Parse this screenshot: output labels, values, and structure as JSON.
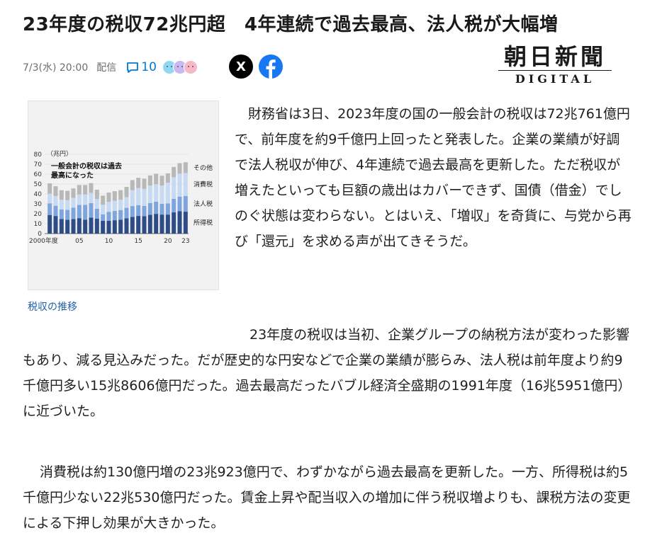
{
  "article": {
    "headline": "23年度の税収72兆円超　4年連続で過去最高、法人税が大幅増",
    "date": "7/3(水) 20:00",
    "delivery_label": "配信",
    "comment_count": "10",
    "share_x_label": "X",
    "publisher_logo_jp": "朝日新聞",
    "publisher_logo_en": "DIGITAL",
    "figure_caption": "税収の推移",
    "paragraphs": [
      "財務省は3日、2023年度の国の一般会計の税収は72兆761億円で、前年度を約9千億円上回ったと発表した。企業の業績が好調で法人税収が伸び、4年連続で過去最高を更新した。ただ税収が増えたといっても巨額の歳出はカバーできず、国債（借金）でしのぐ状態は変わらない。とはいえ、「増収」を奇貨に、与党から再び「還元」を求める声が出てきそうだ。",
      "23年度の税収は当初、企業グループの納税方法が変わった影響もあり、減る見込みだった。だが歴史的な円安などで企業の業績が膨らみ、法人税は前年度より約9千億円多い15兆8606億円だった。過去最高だったバブル経済全盛期の1991年度（16兆5951億円）に近づいた。",
      "消費税は約130億円増の23兆923億円で、わずかながら過去最高を更新した。一方、所得税は約5千億円少ない22兆530億円だった。賃金上昇や配当収入の増加に伴う税収増よりも、課税方法の変更による下押し効果が大きかった。"
    ]
  },
  "icons": {
    "comment": "speech-bubble-icon",
    "reactions": [
      "smile-face-icon",
      "neutral-face-icon",
      "sad-face-icon"
    ],
    "share_x": "x-logo-icon",
    "share_facebook": "facebook-logo-icon"
  },
  "chart_data": {
    "type": "bar",
    "stacked": true,
    "title": "一般会計の税収は過去最高になった",
    "unit_label": "（兆円）",
    "xlabel": "",
    "ylabel": "",
    "ylim": [
      0,
      80
    ],
    "yticks": [
      0,
      10,
      20,
      30,
      40,
      50,
      60,
      70,
      80
    ],
    "x_tick_labels": [
      {
        "year": 2000,
        "label": "2000年度"
      },
      {
        "year": 2005,
        "label": "05"
      },
      {
        "year": 2010,
        "label": "10"
      },
      {
        "year": 2015,
        "label": "15"
      },
      {
        "year": 2020,
        "label": "20"
      },
      {
        "year": 2023,
        "label": "23"
      }
    ],
    "categories": [
      2000,
      2001,
      2002,
      2003,
      2004,
      2005,
      2006,
      2007,
      2008,
      2009,
      2010,
      2011,
      2012,
      2013,
      2014,
      2015,
      2016,
      2017,
      2018,
      2019,
      2020,
      2021,
      2022,
      2023
    ],
    "series": [
      {
        "name": "所得税",
        "color": "#2e4d86",
        "values": [
          18.8,
          17.8,
          14.8,
          13.9,
          14.7,
          15.6,
          14.1,
          16.1,
          15.0,
          12.9,
          13.0,
          13.5,
          14.0,
          15.5,
          16.8,
          17.8,
          17.6,
          18.9,
          19.9,
          19.2,
          19.2,
          21.4,
          22.5,
          22.1
        ]
      },
      {
        "name": "法人税",
        "color": "#7ea6de",
        "values": [
          11.7,
          10.3,
          9.5,
          10.1,
          11.4,
          13.3,
          14.9,
          14.7,
          10.0,
          6.4,
          9.0,
          9.4,
          9.8,
          10.5,
          11.0,
          10.8,
          10.3,
          12.0,
          12.3,
          10.8,
          11.2,
          13.6,
          14.9,
          15.9
        ]
      },
      {
        "name": "消費税",
        "color": "#c6daf3",
        "values": [
          9.8,
          9.8,
          9.8,
          9.7,
          10.0,
          10.6,
          10.5,
          10.3,
          10.0,
          9.8,
          10.0,
          10.2,
          10.4,
          10.8,
          16.0,
          17.4,
          17.2,
          17.5,
          17.7,
          18.4,
          21.0,
          21.9,
          23.1,
          23.1
        ]
      },
      {
        "name": "その他",
        "color": "#b8b8b8",
        "values": [
          10.4,
          9.9,
          9.7,
          9.5,
          9.5,
          9.5,
          9.5,
          9.9,
          9.2,
          9.2,
          9.4,
          9.7,
          9.6,
          10.3,
          10.2,
          10.3,
          10.4,
          10.3,
          10.5,
          10.0,
          9.4,
          10.4,
          10.6,
          10.9
        ]
      }
    ],
    "totals": [
      50.7,
      47.9,
      43.8,
      43.3,
      45.6,
      49.1,
      49.1,
      51.0,
      44.2,
      38.7,
      41.5,
      42.8,
      43.9,
      47.0,
      54.0,
      56.3,
      55.5,
      58.8,
      60.4,
      58.4,
      60.8,
      67.0,
      71.1,
      72.1
    ],
    "annotation": "2023年度 72.1"
  }
}
